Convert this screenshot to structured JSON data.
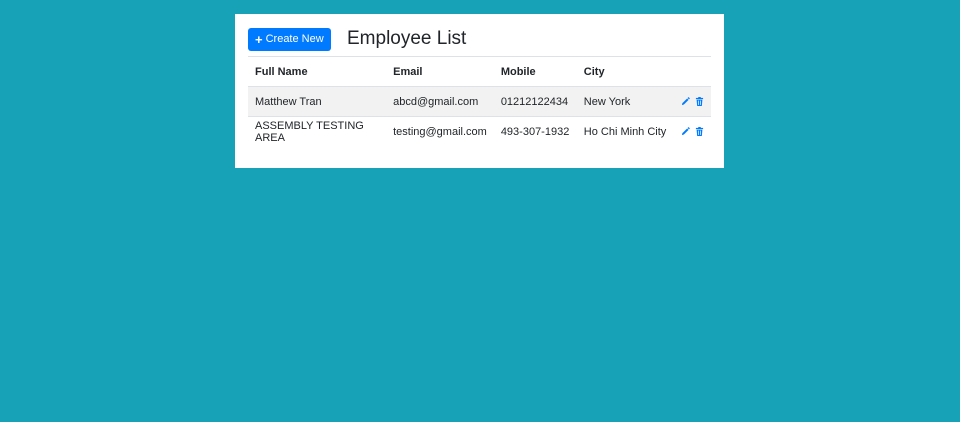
{
  "header": {
    "create_button_label": "Create New",
    "title": "Employee List"
  },
  "table": {
    "columns": [
      "Full Name",
      "Email",
      "Mobile",
      "City"
    ],
    "rows": [
      {
        "full_name": "Matthew Tran",
        "email": "abcd@gmail.com",
        "mobile": "01212122434",
        "city": "New York"
      },
      {
        "full_name": "ASSEMBLY TESTING AREA",
        "email": "testing@gmail.com",
        "mobile": "493-307-1932",
        "city": "Ho Chi Minh City"
      }
    ]
  },
  "colors": {
    "background": "#17a2b8",
    "primary": "#007bff",
    "row_stripe": "#f2f2f2"
  },
  "icons": [
    "plus-icon",
    "pencil-icon",
    "trash-icon"
  ]
}
